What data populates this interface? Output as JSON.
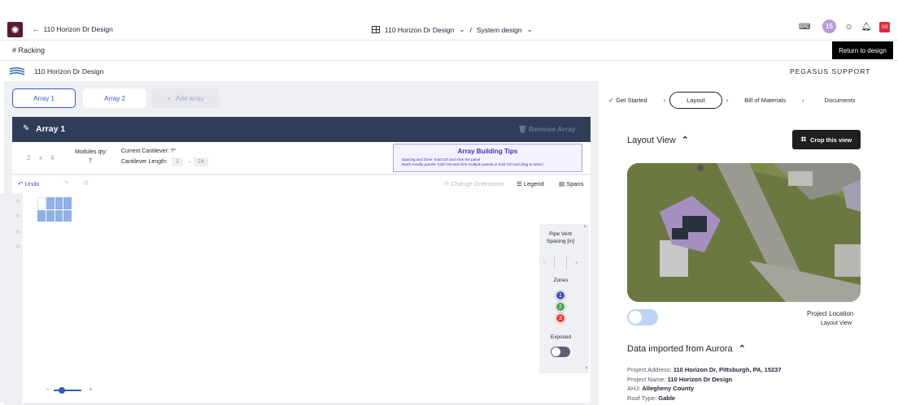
{
  "topbar": {
    "back_title": "110 Horizon Dr Design",
    "crumb_project": "110 Horizon Dr Design",
    "crumb_sep": "/",
    "crumb_page": "System design",
    "notif_count": "15",
    "avatar_initials": "SS"
  },
  "racking": {
    "label": "Racking",
    "return_label": "Return to design"
  },
  "project": {
    "title": "110 Horizon Dr Design",
    "support": "PEGASUS SUPPORT"
  },
  "arrays": {
    "tabs": [
      "Array 1",
      "Array 2"
    ],
    "add_label": "Add array",
    "header_title": "Array 1",
    "remove_label": "Remove Array"
  },
  "info": {
    "dim_a": "2",
    "dim_x": "x",
    "dim_b": "4",
    "modules_label": "Modules qty:",
    "modules_value": "7",
    "cantilever_current": "Current Cantilever: ?\"",
    "cantilever_length_label": "Cantilever Length:",
    "cantilever_min": "1",
    "cantilever_dash": "–",
    "cantilever_max": "24",
    "tips_title": "Array Building Tips",
    "tips_line1": "Spacing and Zone: hold Ctrl and click the panel",
    "tips_line2": "Batch modify panels: hold Ctrl and click multiple panels or hold Ctrl and drag to select"
  },
  "toolbar": {
    "undo": "Undo",
    "change_orientation": "Change Orientation",
    "legend": "Legend",
    "spans": "Spans"
  },
  "panel": {
    "pipe_vent_label": "Pipe Vent Spacing [in]",
    "zones_label": "Zones",
    "zones": [
      "1",
      "2",
      "3"
    ],
    "zone_colors": [
      "#3f51b5",
      "#43a047",
      "#e53935"
    ],
    "exposed_label": "Exposed",
    "minus": "−",
    "plus": "+"
  },
  "zoom": {
    "minus": "−",
    "plus": "+",
    "level": 0.3
  },
  "steps": [
    "Get Started",
    "Layout",
    "Bill of Materials",
    "Documents"
  ],
  "layout": {
    "title": "Layout View",
    "crop_label": "Crop this view",
    "project_location": "Project Location",
    "layout_view_label": "Layout View"
  },
  "aurora": {
    "title": "Data imported from Aurora",
    "address_label": "Project Address:",
    "address_value": "110 Horizon Dr, Pittsburgh, PA, 15237",
    "name_label": "Project Name:",
    "name_value": "110 Horizon Dr Design",
    "ahj_label": "AHJ:",
    "ahj_value": "Allegheny County",
    "roof_label": "Roof Type:",
    "roof_value": "Gable"
  }
}
